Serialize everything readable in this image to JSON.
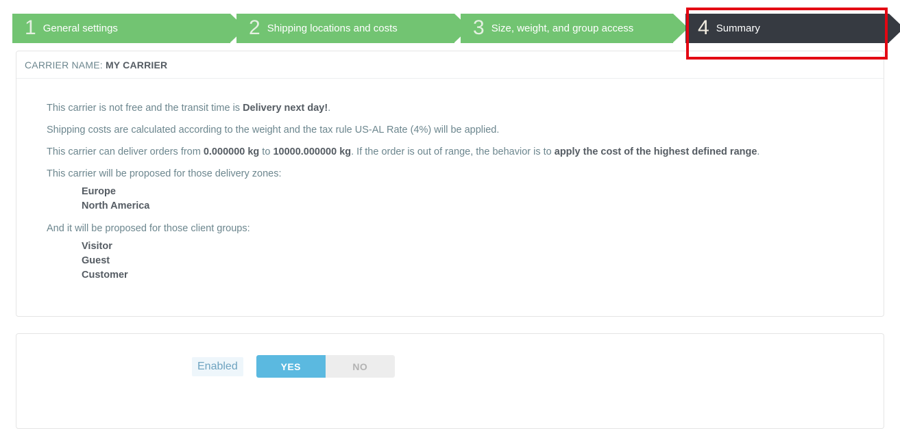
{
  "wizard": {
    "steps": [
      {
        "number": "1",
        "label": "General settings",
        "state": "done"
      },
      {
        "number": "2",
        "label": "Shipping locations and costs",
        "state": "done"
      },
      {
        "number": "3",
        "label": "Size, weight, and group access",
        "state": "done"
      },
      {
        "number": "4",
        "label": "Summary",
        "state": "active"
      }
    ],
    "highlight_color": "#e30613",
    "done_color": "#72c472",
    "active_color": "#363a41"
  },
  "panel": {
    "header": {
      "label": "CARRIER NAME:",
      "carrier_name": "MY CARRIER"
    },
    "summary": {
      "line1_pre": "This carrier is not free and the transit time is ",
      "line1_bold": "Delivery next day!",
      "line1_post": ".",
      "line2": "Shipping costs are calculated according to the weight and the tax rule US-AL Rate (4%) will be applied.",
      "line3_pre": "This carrier can deliver orders from ",
      "line3_min": "0.000000 kg",
      "line3_mid": " to ",
      "line3_max": "10000.000000 kg",
      "line3_post": ". If the order is out of range, the behavior is to ",
      "line3_bold": "apply the cost of the highest defined range",
      "line3_end": ".",
      "zones_intro": "This carrier will be proposed for those delivery zones:",
      "zones": [
        "Europe",
        "North America"
      ],
      "groups_intro": "And it will be proposed for those client groups:",
      "groups": [
        "Visitor",
        "Guest",
        "Customer"
      ]
    }
  },
  "footer": {
    "enabled_label": "Enabled",
    "toggle": {
      "yes_label": "YES",
      "no_label": "NO",
      "selected": "YES",
      "on_color": "#5bb9e0",
      "off_color": "#ededed"
    }
  }
}
